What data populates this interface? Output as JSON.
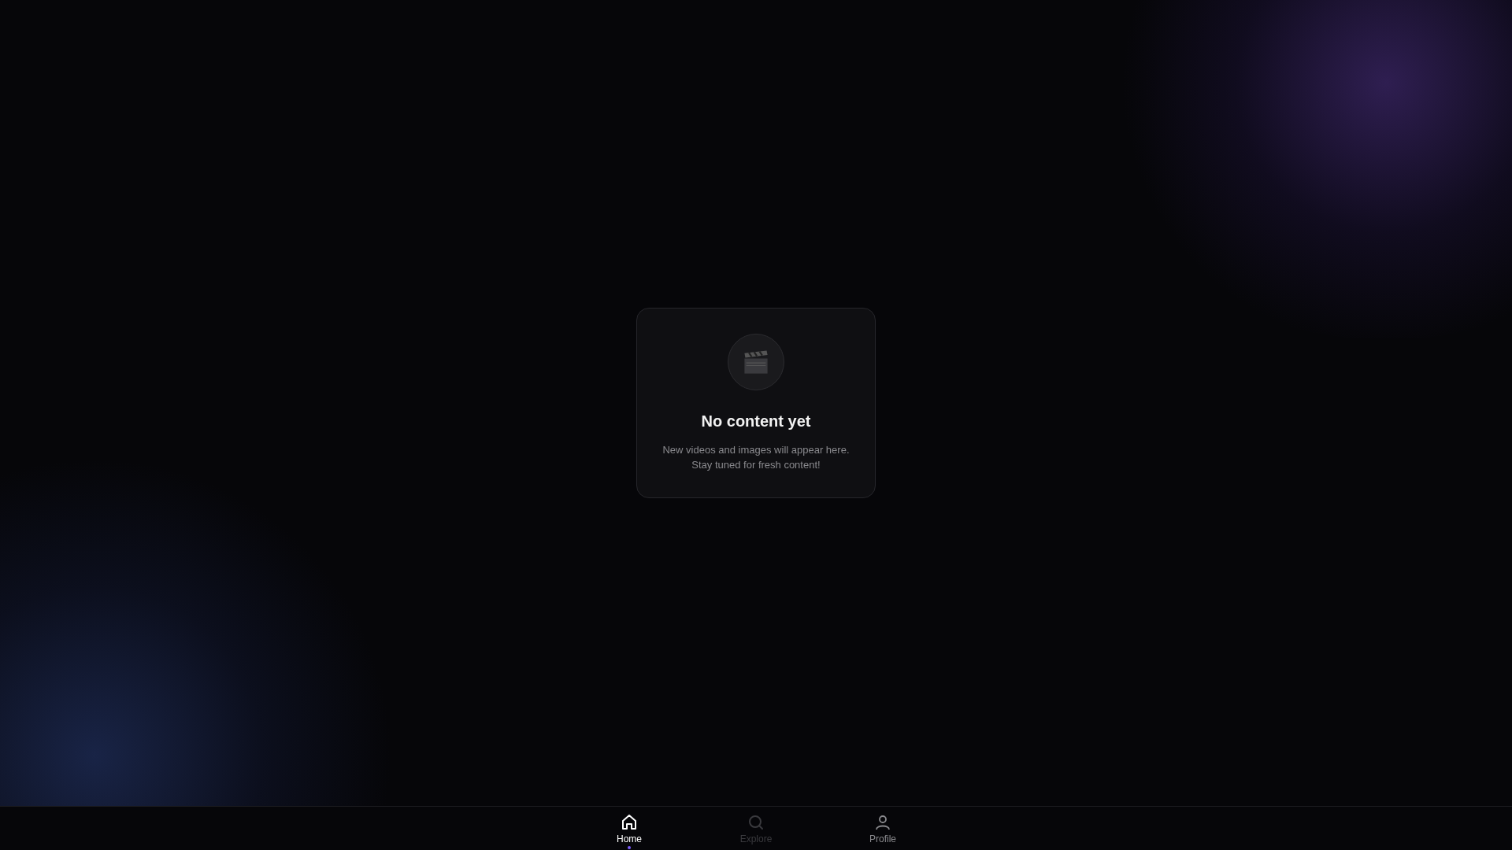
{
  "empty_state": {
    "title": "No content yet",
    "message_lines": [
      "New videos and images will appear here.",
      "Stay tuned for fresh content!"
    ]
  },
  "nav": [
    {
      "kind": "home",
      "label": "Home",
      "selected": true,
      "disabled": false
    },
    {
      "kind": "search",
      "label": "Explore",
      "selected": false,
      "disabled": true
    },
    {
      "kind": "person",
      "label": "Profile",
      "selected": false,
      "disabled": false
    }
  ]
}
